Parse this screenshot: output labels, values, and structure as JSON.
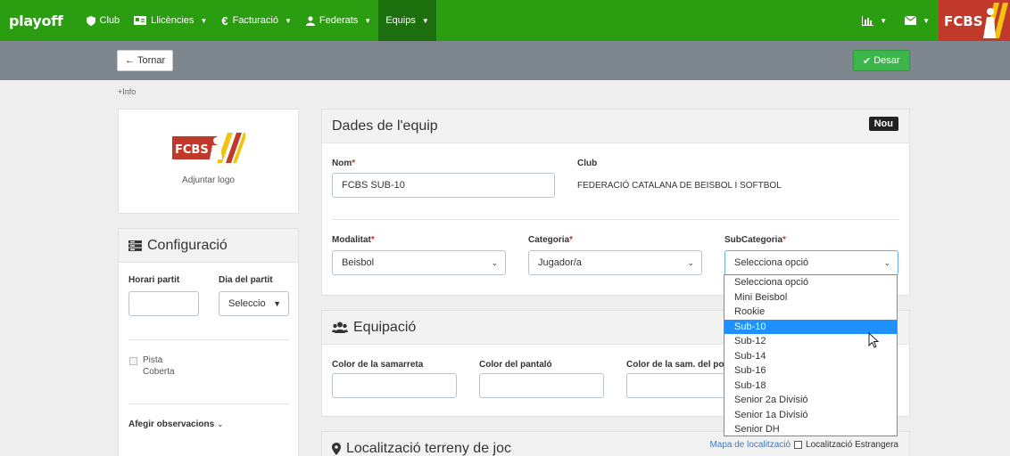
{
  "nav": {
    "brand": "playoff",
    "items": [
      {
        "label": "Club",
        "icon": "shield-icon"
      },
      {
        "label": "Llicències",
        "icon": "id-card-icon"
      },
      {
        "label": "Facturació",
        "icon": "euro-icon"
      },
      {
        "label": "Federats",
        "icon": "user-icon"
      },
      {
        "label": "Equips",
        "icon": ""
      }
    ],
    "right_icons": [
      "bar-chart-icon",
      "envelope-icon"
    ],
    "logo_text": "FCBS"
  },
  "actions": {
    "back": "Tornar",
    "save": "Desar"
  },
  "more_info": "+Info",
  "logo_card": {
    "logo_text": "FCBS",
    "attach": "Adjuntar logo"
  },
  "config": {
    "title": "Configuració",
    "horari_label": "Horari partit",
    "horari_value": "",
    "dia_label": "Dia del partit",
    "dia_value": "Seleccio",
    "pista_label": "Pista",
    "coberta_label": "Coberta",
    "observ_label": "Afegir observacions"
  },
  "dades": {
    "title": "Dades de l'equip",
    "badge": "Nou",
    "nom_label": "Nom",
    "nom_value": "FCBS SUB-10",
    "club_label": "Club",
    "club_value": "FEDERACIÓ CATALANA DE BEISBOL I SOFTBOL",
    "modalitat_label": "Modalitat",
    "modalitat_value": "Beisbol",
    "categoria_label": "Categoria",
    "categoria_value": "Jugador/a",
    "subcat_label": "SubCategoria",
    "subcat_value": "Selecciona opció",
    "required_mark": "*"
  },
  "subcat_options": [
    "Selecciona opció",
    "Mini Beisbol",
    "Rookie",
    "Sub-10",
    "Sub-12",
    "Sub-14",
    "Sub-16",
    "Sub-18",
    "Senior 2a Divisió",
    "Senior 1a Divisió",
    "Senior DH"
  ],
  "subcat_highlighted": "Sub-10",
  "equipacio": {
    "title": "Equipació",
    "samarreta_label": "Color de la samarreta",
    "pantalo_label": "Color del pantaló",
    "sam2_label": "Color de la sam. del po"
  },
  "localitzacio": {
    "title": "Localització terreny de joc",
    "map_link": "Mapa de localització",
    "foreign_label": "Localització Estrangera"
  }
}
